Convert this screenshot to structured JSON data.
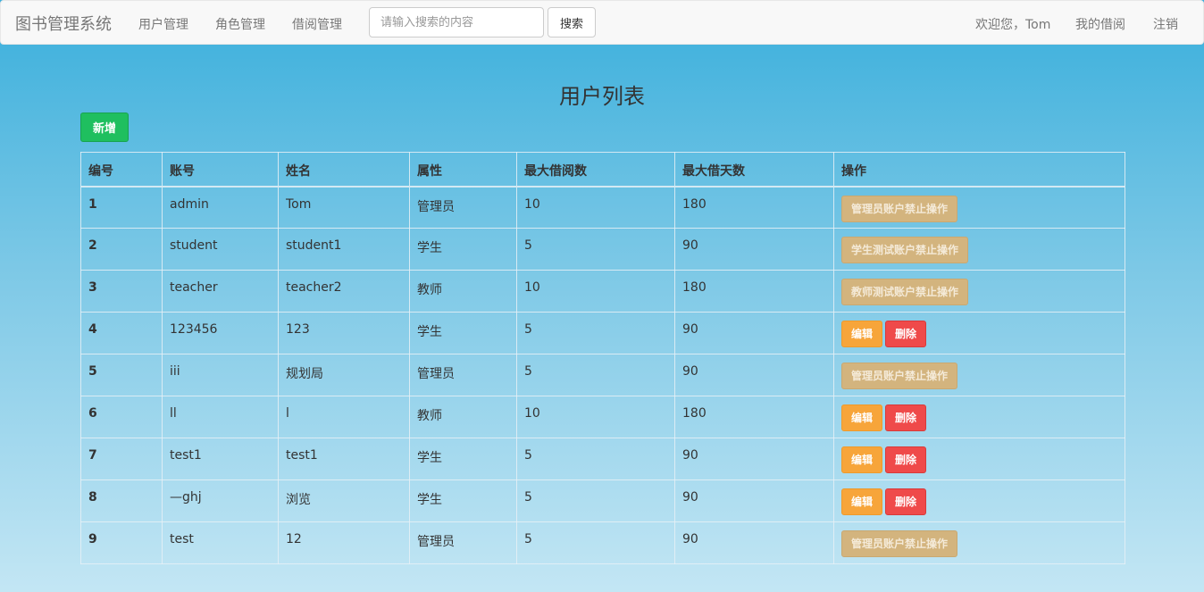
{
  "navbar": {
    "brand": "图书管理系统",
    "links": [
      "用户管理",
      "角色管理",
      "借阅管理"
    ],
    "search": {
      "placeholder": "请输入搜索的内容",
      "button": "搜索"
    },
    "welcome": "欢迎您，Tom",
    "my_borrow": "我的借阅",
    "logout": "注销"
  },
  "page": {
    "title": "用户列表",
    "add_button": "新增"
  },
  "table": {
    "headers": [
      "编号",
      "账号",
      "姓名",
      "属性",
      "最大借阅数",
      "最大借天数",
      "操作"
    ],
    "rows": [
      {
        "id": "1",
        "account": "admin",
        "name": "Tom",
        "role": "管理员",
        "max_borrow": "10",
        "max_days": "180",
        "disabled_label": "管理员账户禁止操作"
      },
      {
        "id": "2",
        "account": "student",
        "name": "student1",
        "role": "学生",
        "max_borrow": "5",
        "max_days": "90",
        "disabled_label": "学生测试账户禁止操作"
      },
      {
        "id": "3",
        "account": "teacher",
        "name": "teacher2",
        "role": "教师",
        "max_borrow": "10",
        "max_days": "180",
        "disabled_label": "教师测试账户禁止操作"
      },
      {
        "id": "4",
        "account": "123456",
        "name": "123",
        "role": "学生",
        "max_borrow": "5",
        "max_days": "90",
        "edit_label": "编辑",
        "delete_label": "删除"
      },
      {
        "id": "5",
        "account": "iii",
        "name": "规划局",
        "role": "管理员",
        "max_borrow": "5",
        "max_days": "90",
        "disabled_label": "管理员账户禁止操作"
      },
      {
        "id": "6",
        "account": "ll",
        "name": "l",
        "role": "教师",
        "max_borrow": "10",
        "max_days": "180",
        "edit_label": "编辑",
        "delete_label": "删除"
      },
      {
        "id": "7",
        "account": "test1",
        "name": "test1",
        "role": "学生",
        "max_borrow": "5",
        "max_days": "90",
        "edit_label": "编辑",
        "delete_label": "删除"
      },
      {
        "id": "8",
        "account": "—ghj",
        "name": "浏览",
        "role": "学生",
        "max_borrow": "5",
        "max_days": "90",
        "edit_label": "编辑",
        "delete_label": "删除"
      },
      {
        "id": "9",
        "account": "test",
        "name": "12",
        "role": "管理员",
        "max_borrow": "5",
        "max_days": "90",
        "disabled_label": "管理员账户禁止操作"
      }
    ]
  }
}
